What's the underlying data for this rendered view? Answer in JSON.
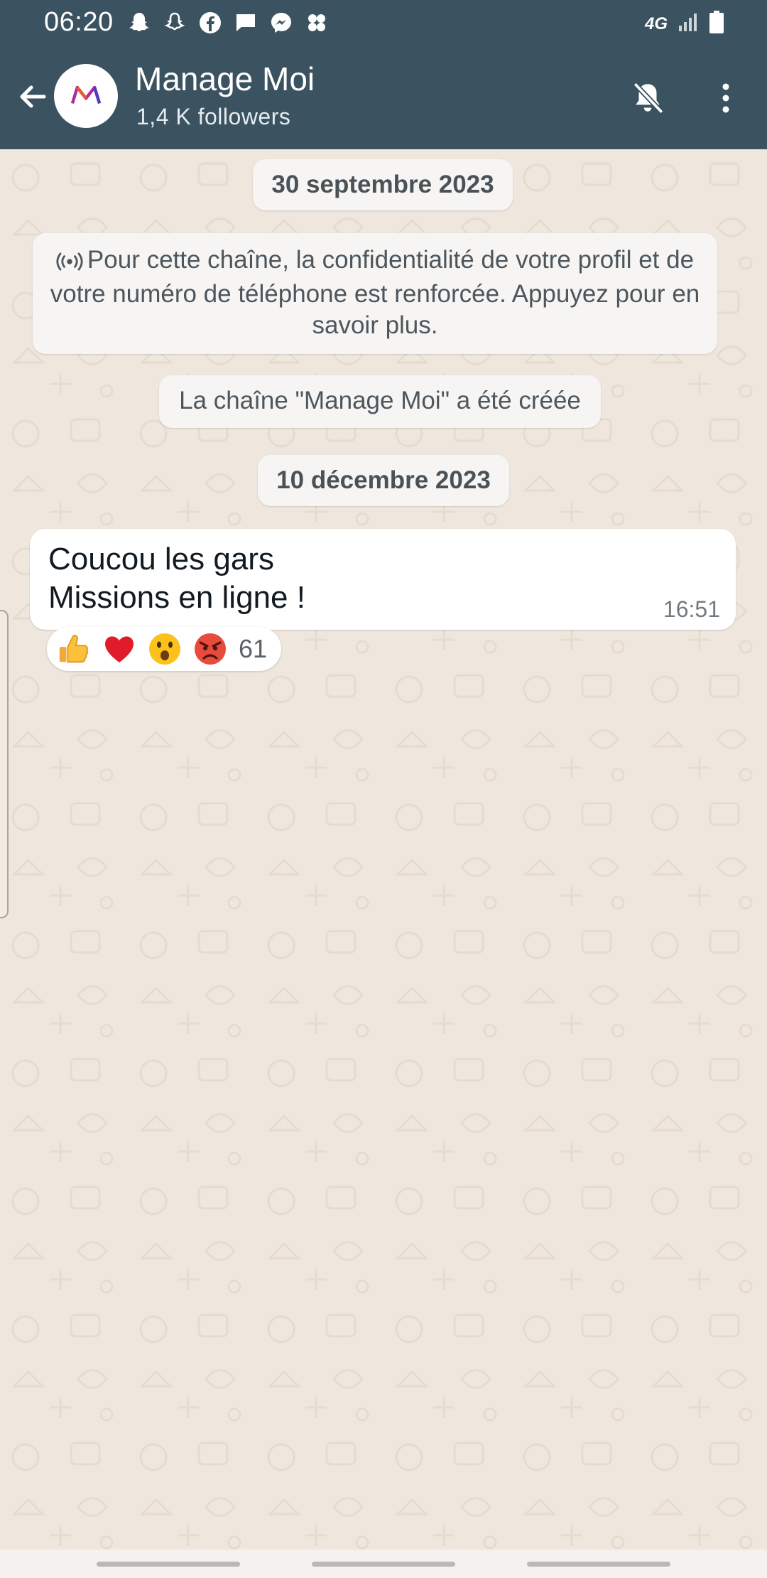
{
  "status_bar": {
    "time": "06:20",
    "left_icons": [
      "snapchat-icon",
      "snapchat-icon",
      "facebook-icon",
      "message-icon",
      "messenger-icon",
      "app-icon"
    ],
    "network": "4G",
    "right_icons": [
      "network-4g-icon",
      "signal-icon",
      "battery-icon"
    ]
  },
  "header": {
    "title": "Manage Moi",
    "subtitle": "1,4 K followers",
    "back_icon": "arrow-left-icon",
    "mute_icon": "bell-off-icon",
    "menu_icon": "more-vertical-icon",
    "avatar_logo": "M"
  },
  "chat": {
    "date_1": "30 septembre 2023",
    "privacy_notice": "Pour cette chaîne, la confidentialité de votre profil et de votre numéro de téléphone est renforcée. Appuyez pour en savoir plus.",
    "created_notice": "La chaîne \"Manage Moi\" a été créée",
    "date_2": "10 décembre 2023",
    "message": {
      "text": "Coucou les gars\nMissions en ligne !",
      "time": "16:51"
    },
    "reactions": {
      "emojis": [
        "thumbs-up",
        "red-heart",
        "astonished-face",
        "angry-face"
      ],
      "count": "61"
    }
  },
  "colors": {
    "header_bg": "#3b5260",
    "chat_bg": "#efe7de",
    "bubble_bg": "#ffffff"
  }
}
